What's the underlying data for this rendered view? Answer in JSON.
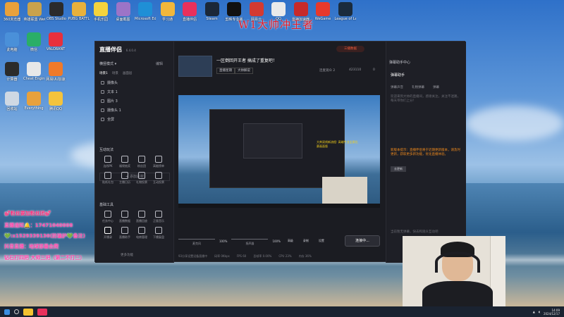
{
  "desktop": {
    "overlay_title": "W1大帅冲王者",
    "icons_top": [
      {
        "label": "360浏览器",
        "color": "#e8a13c"
      },
      {
        "label": "英雄联盟 WeGame版",
        "color": "#c9a24c"
      },
      {
        "label": "OBS Studio",
        "color": "#2b2b2b"
      },
      {
        "label": "PUBG BATTLEGROUNDS",
        "color": "#e8b13c"
      },
      {
        "label": "手机乐园",
        "color": "#f4d33c"
      },
      {
        "label": "桌面截图",
        "color": "#9c74c7"
      },
      {
        "label": "Microsoft Edge",
        "color": "#1f8fd6"
      },
      {
        "label": "学习通",
        "color": "#f1b73b"
      },
      {
        "label": "直播伴侣",
        "color": "#e8305c"
      },
      {
        "label": "Steam",
        "color": "#1b2838"
      },
      {
        "label": "剪映专业版",
        "color": "#111111"
      },
      {
        "label": "网易云",
        "color": "#d33a31"
      },
      {
        "label": "QQ",
        "color": "#eaeaea"
      },
      {
        "label": "雷神加速器",
        "color": "#c62a2a"
      },
      {
        "label": "WeGame",
        "color": "#e7392b"
      },
      {
        "label": "League of Legends",
        "color": "#1a2b3c"
      }
    ],
    "icons_left": [
      {
        "label": "此电脑",
        "color": "#4a90d9"
      },
      {
        "label": "微信",
        "color": "#2aae67"
      },
      {
        "label": "VALORANT",
        "color": "#e8303c"
      },
      {
        "label": "计算器",
        "color": "#2b2b2b"
      },
      {
        "label": "Cheat Engine",
        "color": "#e8e8e8"
      },
      {
        "label": "网易UU加速",
        "color": "#f07a2a"
      },
      {
        "label": "回收站",
        "color": "#cfd8e3"
      },
      {
        "label": "Everything",
        "color": "#e8a13c"
      },
      {
        "label": "腾讯QQ",
        "color": "#f4c33c"
      }
    ],
    "promo_lines": [
      "💕粉丝要加粉丝团💕",
      "直播通知🔔：17471040008",
      "💚:x1529339130(防骗护💚备注)",
      "抖音直播：地球那最会爬",
      "钻石打四把  大师三把（第二不打三）"
    ]
  },
  "app": {
    "logo": "直播伴侣",
    "version": "6.4.0.4",
    "mode": "横竖模式",
    "mode_btn": "编辑",
    "scene_tabs": [
      "场景1",
      "场景",
      "画面层"
    ],
    "sources": [
      "摄像头",
      "文本 1",
      "图片 3",
      "摄像头 1",
      "全屏"
    ],
    "add_source": "+ 添加素材",
    "interact_title": "互动玩法",
    "interact_tools": [
      "连线PK",
      "福袋抽奖",
      "粉丝团",
      "高能榜单",
      "贴纸礼包",
      "主播日历",
      "礼物投票",
      "互动投票"
    ],
    "basic_title": "基础工具",
    "basic_tools": [
      "任务中心",
      "直播数据",
      "直播回放",
      "正版音乐",
      "开播录",
      "直播助手",
      "电商管理",
      "下播复盘"
    ],
    "more_link": "更多功能",
    "stream_title": "一区倒回开王者 搞成了重复吧！",
    "stream_chips": [
      "直播星期",
      "大帅解说"
    ],
    "stream_stats": [
      "连麦观众 2",
      "423110",
      "0"
    ],
    "top_buttons": {
      "live_data": "三播数据",
      "start": "开始直播"
    },
    "preview_text": "大帅双线新流程: 高端专业全屏比赛画面版",
    "audio": [
      {
        "label": "麦克风",
        "pct": "100%"
      },
      {
        "label": "扬声器",
        "pct": "100%"
      }
    ],
    "audio_buttons": [
      "高级",
      "录制",
      "设置"
    ],
    "go_live": "连接中...",
    "status": [
      "93分享设置设备直播中",
      "码率 0Kbps",
      "FPS 60",
      "丢帧率 0.00%",
      "CPU 23%",
      "内存 36%"
    ],
    "right_panel": {
      "header": "弹幕助手中心",
      "title": "弹幕助手",
      "tabs": [
        "弹幕声音",
        "礼物弹幕",
        "弹幕"
      ],
      "hint": "欢迎来到大帅的直播间，感谢关注，关注不迷路，每天带你们上分！",
      "notice_orange": "新版本提示：直播伴侣将于近期更新版本，请及时更新，获取更多新功能，优化直播体验。",
      "button": "去更新",
      "bottom_hint": "当前暂无弹幕，快去和观众互动吧"
    }
  },
  "taskbar": {
    "time": "14:09",
    "date": "2024/12/17"
  }
}
